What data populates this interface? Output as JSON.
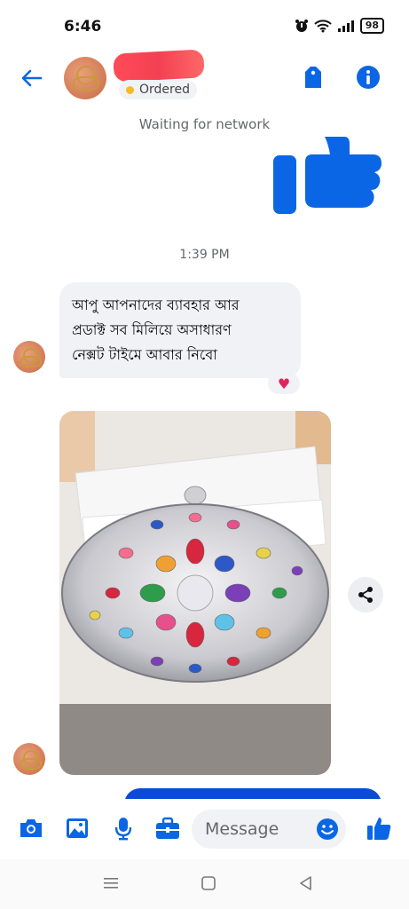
{
  "status_bar": {
    "time": "6:46",
    "battery": "98"
  },
  "header": {
    "order_status": "Ordered"
  },
  "system": {
    "waiting": "Waiting for network"
  },
  "thread": {
    "timestamp": "1:39 PM",
    "message": {
      "lines": [
        "আপু আপনাদের ব্যাবহার আর",
        "প্রডাক্ট  সব মিলিয়ে অসাধারণ",
        "নেক্সট টাইমে আবার নিবো"
      ],
      "reaction": "♥"
    }
  },
  "composer": {
    "placeholder": "Message"
  },
  "colors": {
    "accent": "#0a66e4",
    "bubble": "#f0f2f5",
    "status_dot": "#f7b928",
    "reaction": "#e0245e"
  }
}
